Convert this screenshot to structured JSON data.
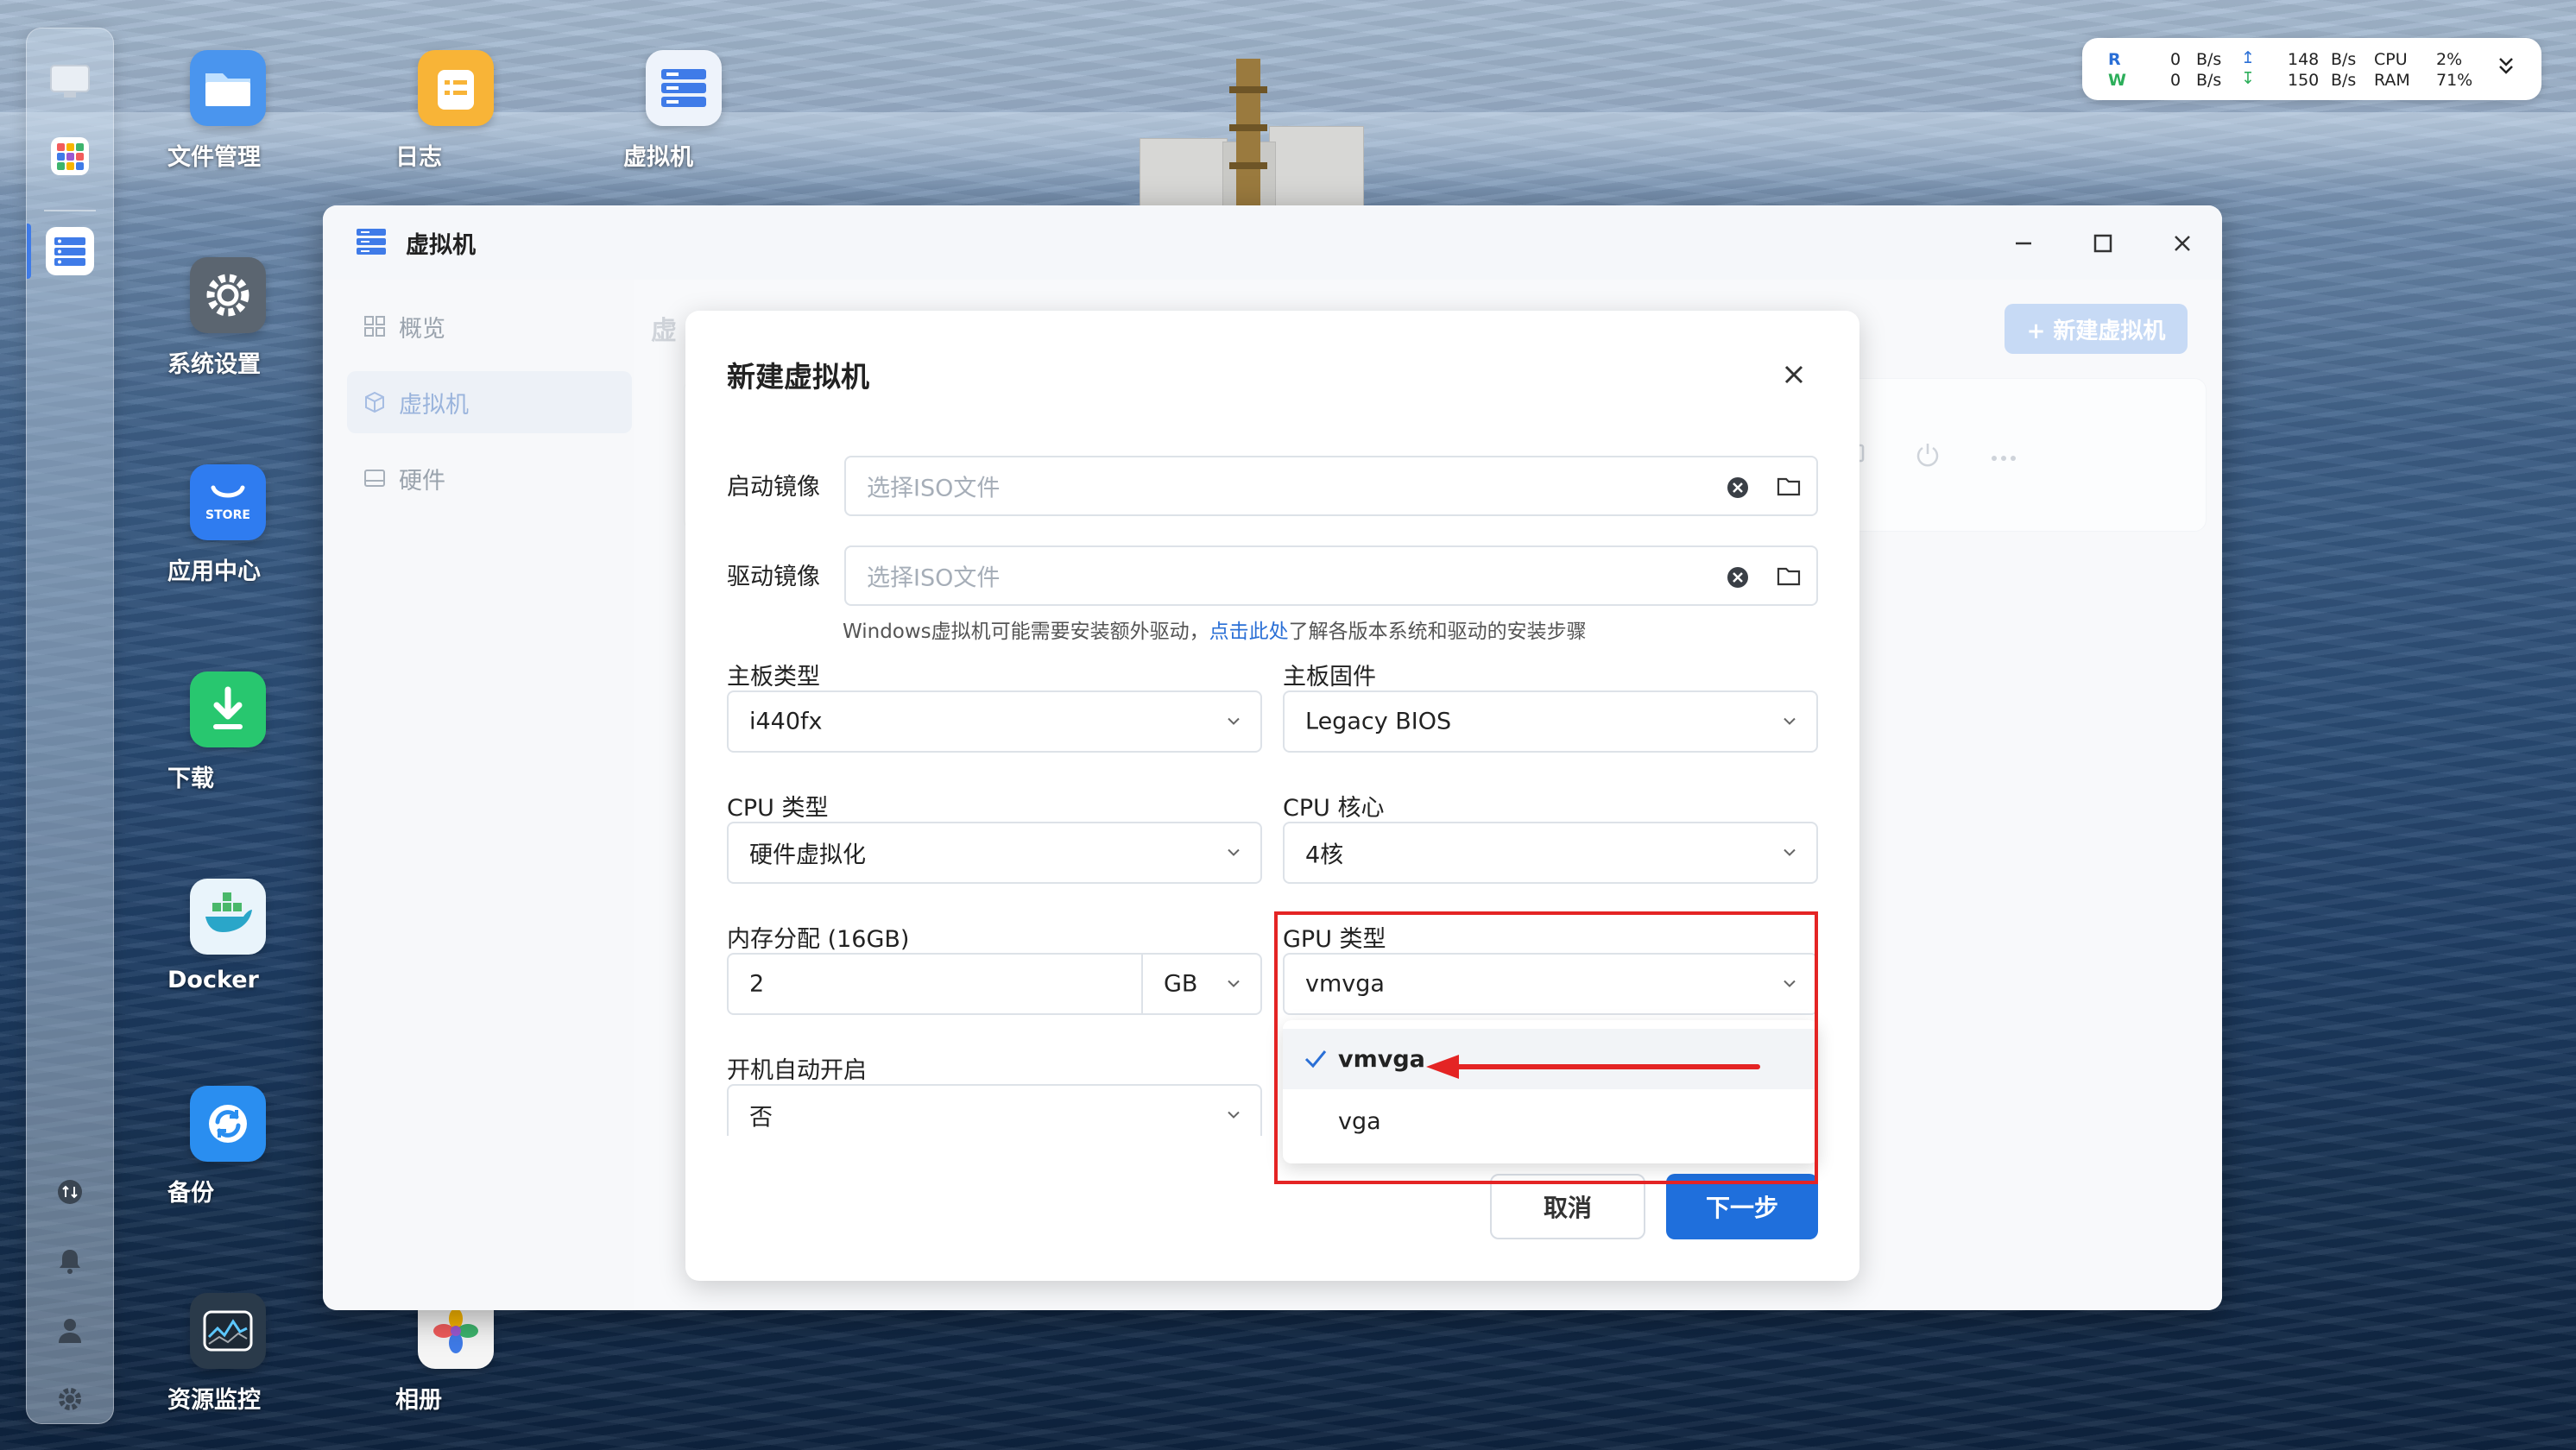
{
  "desktop": {
    "icons": [
      {
        "label": "文件管理",
        "icon": "folder-icon"
      },
      {
        "label": "日志",
        "icon": "notes-icon"
      },
      {
        "label": "虚拟机",
        "icon": "vm-server-icon"
      },
      {
        "label": "系统设置",
        "icon": "gear-icon"
      },
      {
        "label": "应用中心",
        "icon": "store-bag-icon",
        "badge": "STORE"
      },
      {
        "label": "下载",
        "icon": "download-icon"
      },
      {
        "label": "Docker",
        "icon": "docker-whale-icon"
      },
      {
        "label": "备份",
        "icon": "backup-sync-icon"
      },
      {
        "label": "资源监控",
        "icon": "monitor-chart-icon"
      },
      {
        "label": "相册",
        "icon": "photos-flower-icon"
      }
    ]
  },
  "stats": {
    "r_label": "R",
    "w_label": "W",
    "r_val1": "0",
    "r_unit1": "B/s",
    "w_val1": "0",
    "w_unit1": "B/s",
    "r_val2": "148",
    "r_unit2": "B/s",
    "w_val2": "150",
    "w_unit2": "B/s",
    "cpu_label": "CPU",
    "ram_label": "RAM",
    "cpu_val": "2%",
    "ram_val": "71%"
  },
  "window": {
    "title": "虚拟机",
    "sidebar": [
      {
        "label": "概览",
        "icon": "grid-icon"
      },
      {
        "label": "虚拟机",
        "icon": "cube-icon"
      },
      {
        "label": "硬件",
        "icon": "drive-icon"
      }
    ],
    "new_vm_button": "+ 新建虚拟机",
    "partial_heading": "虚"
  },
  "dialog": {
    "title": "新建虚拟机",
    "boot_image_label": "启动镜像",
    "boot_image_placeholder": "选择ISO文件",
    "driver_image_label": "驱动镜像",
    "driver_image_placeholder": "选择ISO文件",
    "hint_prefix": "Windows虚拟机可能需要安装额外驱动，",
    "hint_link": "点击此处",
    "hint_suffix": "了解各版本系统和驱动的安装步骤",
    "board_type_label": "主板类型",
    "board_type_value": "i440fx",
    "board_fw_label": "主板固件",
    "board_fw_value": "Legacy BIOS",
    "cpu_type_label": "CPU 类型",
    "cpu_type_value": "硬件虚拟化",
    "cpu_cores_label": "CPU 核心",
    "cpu_cores_value": "4核",
    "memory_label": "内存分配 (16GB)",
    "memory_value": "2",
    "memory_unit": "GB",
    "gpu_label": "GPU 类型",
    "gpu_value": "vmvga",
    "gpu_options": [
      "vmvga",
      "vga"
    ],
    "autostart_label": "开机自动开启",
    "autostart_value": "否",
    "cancel": "取消",
    "next": "下一步"
  },
  "colors": {
    "accent": "#1f6fdc",
    "highlight_box": "#e42424",
    "arrow": "#e42424"
  }
}
